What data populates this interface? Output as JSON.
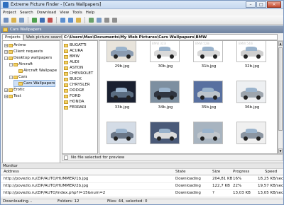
{
  "window": {
    "title": "Extreme Picture Finder - [Cars Wallpapers]"
  },
  "menu": [
    "Project",
    "Search",
    "Download",
    "View",
    "Tools",
    "Help"
  ],
  "address_bar": {
    "title": "Cars Wallpapers"
  },
  "left_tabs": [
    "Projects",
    "Web picture search"
  ],
  "tree": [
    {
      "label": "Anime",
      "level": 0,
      "expand": "+"
    },
    {
      "label": "Client requests",
      "level": 0,
      "expand": "+"
    },
    {
      "label": "Desktop wallpapers",
      "level": 0,
      "expand": "-"
    },
    {
      "label": "Aircraft",
      "level": 1,
      "expand": "-"
    },
    {
      "label": "Aircraft Wallpape",
      "level": 2,
      "expand": ""
    },
    {
      "label": "Cars",
      "level": 1,
      "expand": "-"
    },
    {
      "label": "Cars Wallpapers",
      "level": 2,
      "expand": "",
      "selected": true
    },
    {
      "label": "Erotic",
      "level": 0,
      "expand": "+"
    },
    {
      "label": "Test",
      "level": 0,
      "expand": "+"
    }
  ],
  "path": "C:\\Users\\Max\\Documents\\My Web Pictures\\Cars Wallpapers\\BMW",
  "folders": [
    "BUGATTI",
    "ACURA",
    "BMW",
    "AUDI",
    "ASTON",
    "CHEVROLET",
    "BUICK",
    "CHRYSLER",
    "DODGE",
    "FORD",
    "HONDA",
    "FERRARI"
  ],
  "thumbnails": [
    {
      "name": "29b.jpg",
      "stamp": "",
      "color": "#8a9bb0",
      "bg": "#e8e4dc"
    },
    {
      "name": "30b.jpg",
      "stamp": "BMW 323i",
      "color": "#d9d9d9",
      "bg": "#ffffff"
    },
    {
      "name": "31b.jpg",
      "stamp": "BMW 528i",
      "color": "#d9d9d9",
      "bg": "#ffffff"
    },
    {
      "name": "32b.jpg",
      "stamp": "BMW 540i",
      "color": "#cfcfcf",
      "bg": "#ffffff"
    },
    {
      "name": "33b.jpg",
      "stamp": "",
      "color": "#5a6c80",
      "bg": "#1a2030"
    },
    {
      "name": "34b.jpg",
      "stamp": "",
      "color": "#2f3540",
      "bg": "#7d8fa0"
    },
    {
      "name": "35b.jpg",
      "stamp": "",
      "color": "#bcc4cc",
      "bg": "#5870a0"
    },
    {
      "name": "36b.jpg",
      "stamp": "",
      "color": "#9ea6ae",
      "bg": "#eef0f2"
    },
    {
      "name": "",
      "stamp": "",
      "color": "#6a7686",
      "bg": "#d4dce6"
    },
    {
      "name": "",
      "stamp": "",
      "color": "#dcdcdc",
      "bg": "#4a5a78"
    },
    {
      "name": "",
      "stamp": "",
      "color": "#c0c6cc",
      "bg": "#a8b4c0"
    },
    {
      "name": "",
      "stamp": "",
      "color": "#8c96a2",
      "bg": "#f0f0f0"
    }
  ],
  "preview": {
    "text": "No file selected for preview"
  },
  "monitor": {
    "title": "Monitor",
    "columns": [
      "Address",
      "State",
      "Size",
      "Progress",
      "Speed"
    ],
    "rows": [
      {
        "address": "http://povezlo.ru/ZIP/AUTO/HUMMER/1b.jpg",
        "state": "Downloading",
        "size": "204,81 KB",
        "progress": "16%",
        "speed": "18,25 KB/sec"
      },
      {
        "address": "http://povezlo.ru/ZIP/AUTO/HUMMER/2b.jpg",
        "state": "Downloading",
        "size": "122,7 KB",
        "progress": "22%",
        "speed": "19,57 KB/sec"
      },
      {
        "address": "http://povezlo.ru/ZIP/AUTO/index.php?l=15&num=2",
        "state": "Downloading",
        "size": "?",
        "progress": "13,03 KB",
        "speed": "13,05 KB/sec"
      }
    ]
  },
  "status": {
    "state": "Downloading...",
    "folders": "Folders: 12",
    "files": "Files: 44, selected: 0"
  },
  "toolbar_icons": [
    {
      "name": "new-project-icon",
      "color": "#6f8fbf"
    },
    {
      "name": "open-icon",
      "color": "#d9b24c"
    },
    {
      "name": "properties-icon",
      "color": "#7a9cc6"
    },
    {
      "name": "start-icon",
      "color": "#4ea04e"
    },
    {
      "name": "pause-icon",
      "color": "#3f6fb5"
    },
    {
      "name": "stop-icon",
      "color": "#c05050"
    },
    {
      "name": "back-icon",
      "color": "#5b8fd0"
    },
    {
      "name": "forward-icon",
      "color": "#5b8fd0"
    },
    {
      "name": "up-folder-icon",
      "color": "#d9b24c"
    },
    {
      "name": "slideshow-icon",
      "color": "#6aa06a"
    },
    {
      "name": "thumbnails-icon",
      "color": "#7a9cc6"
    },
    {
      "name": "view-icon",
      "color": "#8f8f8f"
    },
    {
      "name": "options-icon",
      "color": "#8f8f8f"
    }
  ]
}
